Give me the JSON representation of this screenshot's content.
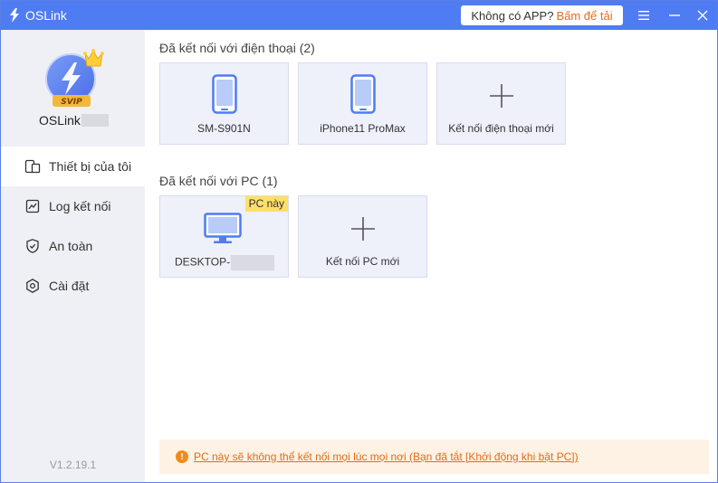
{
  "app": {
    "title": "OSLink",
    "version": "V1.2.19.1"
  },
  "header": {
    "download_question": "Không có APP?",
    "download_action": "Bấm để tải",
    "menu_icon": "menu-icon",
    "minimize_icon": "minimize-icon",
    "close_icon": "close-icon"
  },
  "user": {
    "name": "OSLink",
    "vip_badge": "SVIP"
  },
  "sidebar": {
    "items": [
      {
        "label": "Thiết bị của tôi",
        "icon": "devices-icon",
        "active": true
      },
      {
        "label": "Log kết nối",
        "icon": "log-icon",
        "active": false
      },
      {
        "label": "An toàn",
        "icon": "shield-icon",
        "active": false
      },
      {
        "label": "Cài đặt",
        "icon": "settings-icon",
        "active": false
      }
    ]
  },
  "phones": {
    "title": "Đã kết nối với điện thoại (2)",
    "devices": [
      {
        "name": "SM-S901N",
        "icon": "phone-icon"
      },
      {
        "name": "iPhone11 ProMax",
        "icon": "phone-icon"
      }
    ],
    "add_label": "Kết nối điện thoại mới"
  },
  "pcs": {
    "title": "Đã kết nối với PC (1)",
    "devices": [
      {
        "name": "DESKTOP-",
        "icon": "monitor-icon",
        "badge": "PC này"
      }
    ],
    "add_label": "Kết nối PC mới"
  },
  "warning": {
    "text": "PC này sẽ không thể kết nối mọi lúc mọi nơi (Bạn đã tắt [Khởi động khi bật PC])"
  },
  "colors": {
    "accent": "#4f7cf2",
    "warning": "#e76a17",
    "card_bg": "#eef0fa",
    "sidebar_bg": "#eef0f6"
  }
}
